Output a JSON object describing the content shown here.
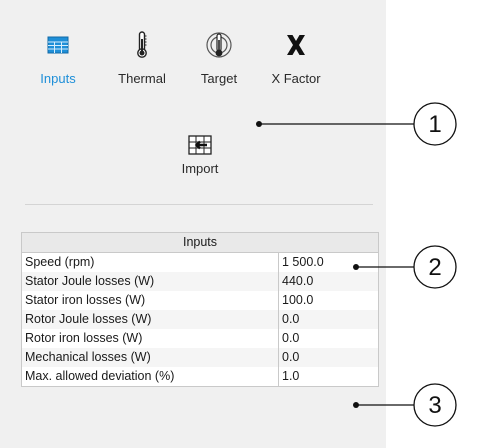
{
  "toolbar": {
    "tools": [
      {
        "label": "Inputs",
        "icon": "table-icon",
        "active": true
      },
      {
        "label": "Thermal",
        "icon": "thermometer-icon",
        "active": false
      },
      {
        "label": "Target",
        "icon": "target-thermometer-icon",
        "active": false
      },
      {
        "label": "X Factor",
        "icon": "x-factor-icon",
        "active": false
      }
    ],
    "import": {
      "label": "Import",
      "icon": "import-icon"
    }
  },
  "inputs_table": {
    "title": "Inputs",
    "rows": [
      {
        "name": "Speed (rpm)",
        "value": "1 500.0"
      },
      {
        "name": "Stator Joule losses (W)",
        "value": "440.0"
      },
      {
        "name": "Stator iron losses (W)",
        "value": "100.0"
      },
      {
        "name": "Rotor Joule losses (W)",
        "value": "0.0"
      },
      {
        "name": "Rotor iron losses (W)",
        "value": "0.0"
      },
      {
        "name": "Mechanical losses (W)",
        "value": "0.0"
      },
      {
        "name": "Max. allowed deviation (%)",
        "value": "1.0"
      }
    ]
  },
  "callouts": [
    "1",
    "2",
    "3"
  ],
  "colors": {
    "accent": "#1e8fd8",
    "panel": "#f0f0f0",
    "grid": "#c9c9c9"
  }
}
